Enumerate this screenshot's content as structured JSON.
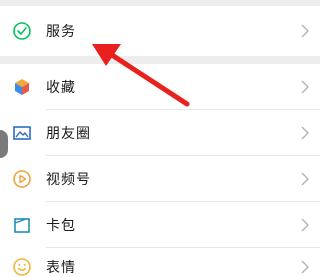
{
  "menu": {
    "service": {
      "label": "服务",
      "icon": "wechat-pay-icon"
    },
    "items": [
      {
        "label": "收藏",
        "icon": "favorites-cube-icon"
      },
      {
        "label": "朋友圈",
        "icon": "moments-picture-icon"
      },
      {
        "label": "视频号",
        "icon": "channels-play-icon"
      },
      {
        "label": "卡包",
        "icon": "card-wallet-icon"
      },
      {
        "label": "表情",
        "icon": "stickers-smiley-icon"
      }
    ]
  },
  "colors": {
    "background": "#ededed",
    "row": "#ffffff",
    "text": "#1a1a1a",
    "chevron": "#b2b2b2",
    "service_green": "#07c160",
    "favorites_yellow": "#f2a93b",
    "favorites_blue": "#3b8ee8",
    "moments_blue": "#2b6cc4",
    "channels_orange": "#f0a23b",
    "card_teal": "#1f8fb5",
    "stickers_yellow": "#f1b53a",
    "annotation_red": "#e8211e"
  }
}
